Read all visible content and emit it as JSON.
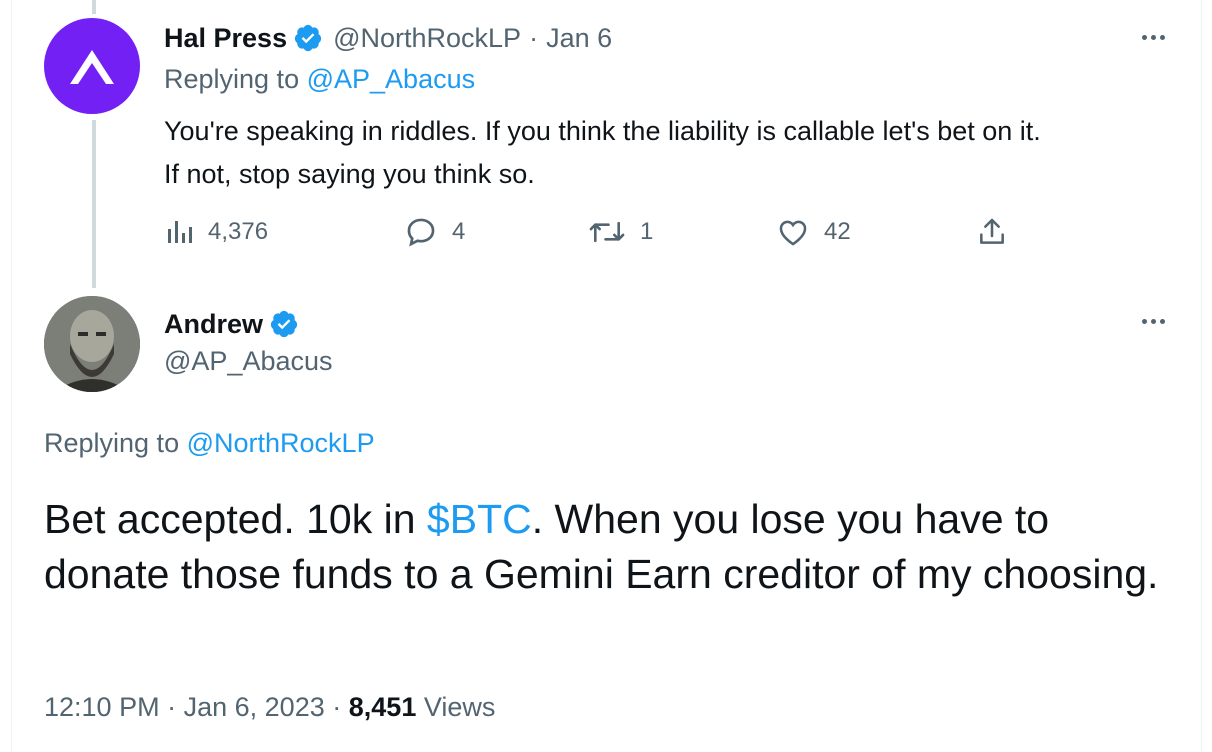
{
  "tweet1": {
    "display_name": "Hal Press",
    "handle": "@NorthRockLP",
    "separator": "·",
    "date": "Jan 6",
    "replying_prefix": "Replying to",
    "replying_to": "@AP_Abacus",
    "text_line1": "You're speaking in riddles. If you think the liability is callable let's bet on it.",
    "text_line2": "If not, stop saying you think so.",
    "stats": {
      "views": "4,376",
      "replies": "4",
      "retweets": "1",
      "likes": "42"
    },
    "avatar_icon": "chevron-logo-icon",
    "avatar_color": "#7320f5"
  },
  "tweet2": {
    "display_name": "Andrew",
    "handle": "@AP_Abacus",
    "replying_prefix": "Replying to",
    "replying_to": "@NorthRockLP",
    "text_before": "Bet accepted. 10k in ",
    "cashtag": "$BTC",
    "text_after": ". When you lose you have to donate those funds to a Gemini Earn creditor of my choosing.",
    "time": "12:10 PM",
    "sep1": "·",
    "date": "Jan 6, 2023",
    "sep2": "·",
    "views_count": "8,451",
    "views_label": "Views"
  },
  "colors": {
    "link": "#1d9bf0",
    "muted": "#536471",
    "text": "#0f1419",
    "verified": "#1d9bf0",
    "thread_line": "#cfd9de"
  },
  "icons": [
    "verified-badge-icon",
    "more-icon",
    "views-icon",
    "reply-icon",
    "retweet-icon",
    "like-icon",
    "share-icon"
  ]
}
